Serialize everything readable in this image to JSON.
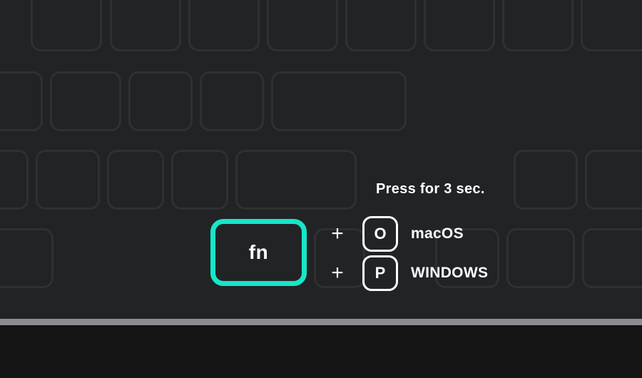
{
  "instruction": "Press for 3 sec.",
  "fn_key_label": "fn",
  "combos": {
    "mac": {
      "plus": "+",
      "key": "O",
      "os": "macOS"
    },
    "win": {
      "plus": "+",
      "key": "P",
      "os": "WINDOWS"
    }
  },
  "colors": {
    "accent": "#17e6c8",
    "background": "#222325",
    "key_outline": "#2f3032"
  }
}
